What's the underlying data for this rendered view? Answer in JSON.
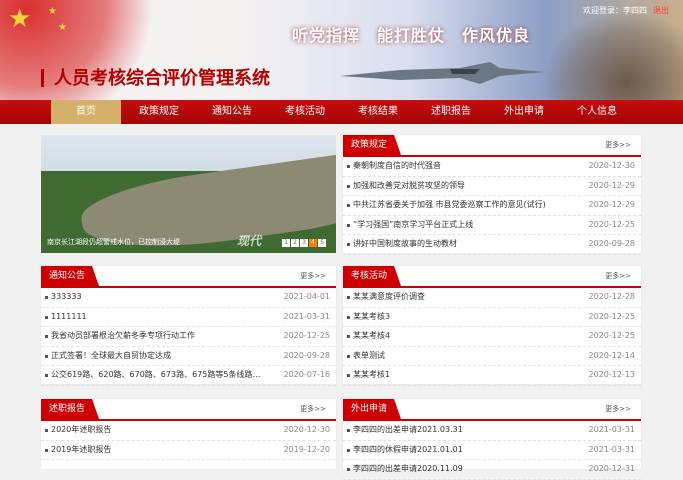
{
  "header": {
    "slogan": "听党指挥　能打胜仗　作风优良",
    "title": "人员考核综合评价管理系统",
    "login_text": "欢迎登录：李四四",
    "logout": "退出"
  },
  "nav": [
    "首页",
    "政策规定",
    "通知公告",
    "考核活动",
    "考核结果",
    "述职报告",
    "外出申请",
    "个人信息"
  ],
  "carousel": {
    "caption": "南京长江湖段仍超警戒水位，已控制浸大堤",
    "watermark": "现代",
    "pages": [
      "1",
      "2",
      "3",
      "4",
      "5"
    ],
    "active_page": "4"
  },
  "more_label": "更多>>",
  "panels": {
    "policy": {
      "title": "政策规定",
      "items": [
        {
          "text": "秦朝制度自信的时代强音",
          "date": "2020-12-30"
        },
        {
          "text": "加强和改善党对脱贫攻坚的领导",
          "date": "2020-12-29"
        },
        {
          "text": "中共江苏省委关于加强 市县党委巡察工作的意见(试行)",
          "date": "2020-12-29"
        },
        {
          "text": "“学习强国”南京学习平台正式上线",
          "date": "2020-12-25"
        },
        {
          "text": "讲好中国制度故事的生动教材",
          "date": "2020-09-28"
        }
      ]
    },
    "notice": {
      "title": "通知公告",
      "items": [
        {
          "text": "333333",
          "date": "2021-04-01"
        },
        {
          "text": "1111111",
          "date": "2021-03-31"
        },
        {
          "text": "我省动员部署根治欠薪冬季专项行动工作",
          "date": "2020-12-25"
        },
        {
          "text": "正式签署！全球最大自贸协定达成",
          "date": "2020-09-28"
        },
        {
          "text": "公交619路、620路、670路、673路、675路等5条线路走向优化调整",
          "date": "2020-07-16"
        }
      ]
    },
    "activity": {
      "title": "考核活动",
      "items": [
        {
          "text": "某某满意度评价调查",
          "date": "2020-12-28"
        },
        {
          "text": "某某考核3",
          "date": "2020-12-25"
        },
        {
          "text": "某某考核4",
          "date": "2020-12-25"
        },
        {
          "text": "表单测试",
          "date": "2020-12-14"
        },
        {
          "text": "某某考核1",
          "date": "2020-12-13"
        }
      ]
    },
    "report": {
      "title": "述职报告",
      "items": [
        {
          "text": "2020年述职报告",
          "date": "2020-12-30"
        },
        {
          "text": "2019年述职报告",
          "date": "2019-12-20"
        }
      ]
    },
    "leave": {
      "title": "外出申请",
      "items": [
        {
          "text": "李四四的出差申请2021.03.31",
          "date": "2021-03-31"
        },
        {
          "text": "李四四的休假申请2021.01.01",
          "date": "2021-03-31"
        },
        {
          "text": "李四四的出差申请2020.11.09",
          "date": "2020-12-31"
        }
      ]
    }
  }
}
